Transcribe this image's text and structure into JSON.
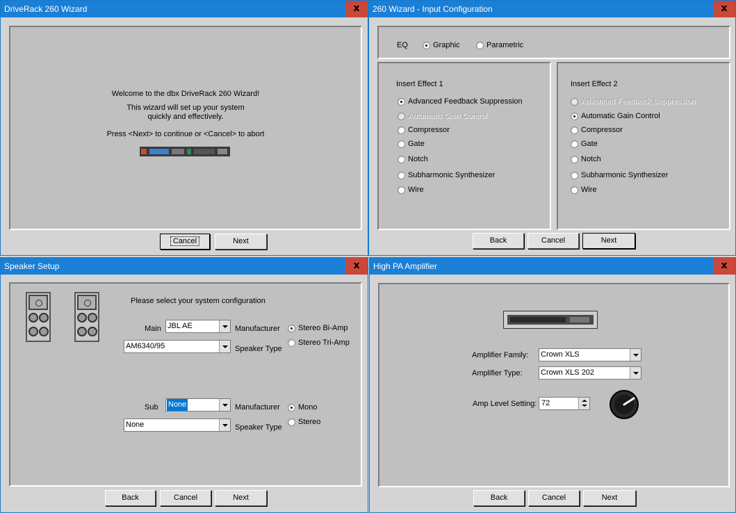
{
  "win1": {
    "title": "DriveRack 260 Wizard",
    "close_label": "x",
    "welcome": "Welcome to the dbx DriveRack 260 Wizard!",
    "line2": "This wizard will set up your system",
    "line3": "quickly and effectively.",
    "line4": "Press <Next> to continue or <Cancel> to abort",
    "cancel_label": "Cancel",
    "next_label": "Next"
  },
  "win2": {
    "title": "260 Wizard - Input Configuration",
    "close_label": "x",
    "eq_label": "EQ",
    "eq_options": [
      "Graphic",
      "Parametric"
    ],
    "eq_selected": "Graphic",
    "insert1": {
      "title": "Insert Effect 1",
      "options": [
        "Advanced Feedback Suppression",
        "Automatic Gain Control",
        "Compressor",
        "Gate",
        "Notch",
        "Subharmonic Synthesizer",
        "Wire"
      ],
      "selected": "Advanced Feedback Suppression",
      "disabled": [
        "Automatic Gain Control"
      ]
    },
    "insert2": {
      "title": "Insert Effect 2",
      "options": [
        "Advanced Feedback Suppression",
        "Automatic Gain Control",
        "Compressor",
        "Gate",
        "Notch",
        "Subharmonic Synthesizer",
        "Wire"
      ],
      "selected": "Automatic Gain Control",
      "disabled": [
        "Advanced Feedback Suppression"
      ]
    },
    "back_label": "Back",
    "cancel_label": "Cancel",
    "next_label": "Next"
  },
  "win3": {
    "title": "Speaker Setup",
    "close_label": "x",
    "prompt": "Please select your system configuration",
    "main_label": "Main",
    "main_manufacturer": "JBL AE",
    "main_speaker_type": "AM6340/95",
    "manufacturer_label": "Manufacturer",
    "speaker_type_label": "Speaker Type",
    "main_amp_options": [
      "Stereo Bi-Amp",
      "Stereo Tri-Amp"
    ],
    "main_amp_selected": "Stereo Bi-Amp",
    "sub_label": "Sub",
    "sub_manufacturer": "None",
    "sub_speaker_type": "None",
    "sub_options": [
      "Mono",
      "Stereo"
    ],
    "sub_selected": "Mono",
    "back_label": "Back",
    "cancel_label": "Cancel",
    "next_label": "Next"
  },
  "win4": {
    "title": "High PA Amplifier",
    "close_label": "x",
    "family_label": "Amplifier Family:",
    "family_value": "Crown XLS",
    "type_label": "Amplifier Type:",
    "type_value": "Crown XLS 202",
    "level_label": "Amp Level Setting:",
    "level_value": "72",
    "back_label": "Back",
    "cancel_label": "Cancel",
    "next_label": "Next"
  }
}
